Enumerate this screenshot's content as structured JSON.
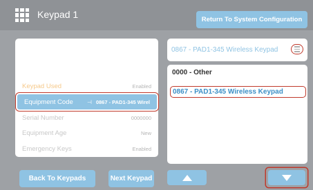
{
  "header": {
    "title": "Keypad 1",
    "return_label": "Return To System Configuration",
    "icon": "keypad-grid-icon"
  },
  "details": {
    "rows": [
      {
        "label": "Keypad Used",
        "value": "Enabled"
      },
      {
        "label": "Equipment Code",
        "value": "0867 - PAD1-345 Wirel",
        "icon": "separator-icon"
      },
      {
        "label": "Serial Number",
        "value": "0000000"
      },
      {
        "label": "Equipment Age",
        "value": "New"
      },
      {
        "label": "Emergency Keys",
        "value": "Enabled"
      }
    ]
  },
  "selector": {
    "current": "0867 - PAD1-345 Wireless Keypad",
    "menu_icon": "menu-icon",
    "options": [
      "0000 - Other",
      "0867 - PAD1-345 Wireless Keypad"
    ]
  },
  "footer": {
    "back_label": "Back To Keypads",
    "next_label": "Next Keypad",
    "up_icon": "arrow-up-icon",
    "down_icon": "arrow-down-icon"
  },
  "colors": {
    "accent": "#8fc3e3",
    "highlight": "#c0392b",
    "background": "#9ea1a5"
  }
}
